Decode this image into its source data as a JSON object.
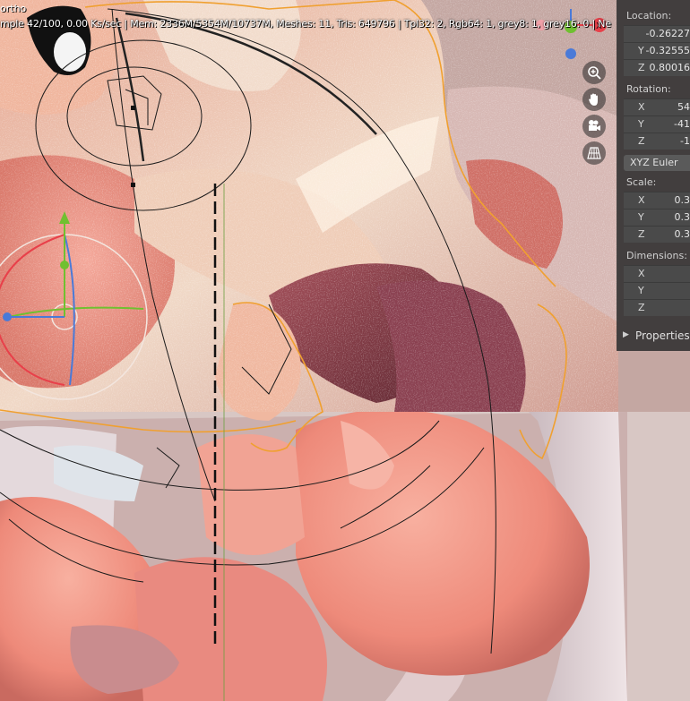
{
  "viewport": {
    "title_fragment": "ortho",
    "status": "mple 42/100, 0.00 Ks/sec | Mem: 2336M/5354M/10737M, Meshes: 11, Tris: 649796 | Tpl32: 2, Rgb64: 1, grey8: 1, grey16: 0 | Ne"
  },
  "gizmo": {
    "axis_x": "X",
    "axis_y": "Y",
    "axis_z": "Z"
  },
  "nav": {
    "zoom_icon": "zoom-icon",
    "pan_icon": "hand-icon",
    "camera_icon": "camera-icon",
    "grid_icon": "perspective-grid-icon"
  },
  "panel": {
    "location": {
      "label": "Location:",
      "x": "-0.26227",
      "y": "-0.32555",
      "z": "0.80016"
    },
    "rotation": {
      "label": "Rotation:",
      "x": "54",
      "y": "-41",
      "z": "-1",
      "mode": "XYZ Euler"
    },
    "scale": {
      "label": "Scale:",
      "x": "0.3",
      "y": "0.3",
      "z": "0.3"
    },
    "dimensions": {
      "label": "Dimensions:",
      "x": "",
      "y": "",
      "z": ""
    },
    "properties_label": "Properties",
    "axis_x": "X",
    "axis_y": "Y",
    "axis_z": "Z"
  },
  "colors": {
    "gizmo_x": "#e8404a",
    "gizmo_y": "#70c030",
    "gizmo_z": "#4a7ad8",
    "selection_outline": "#f0a030",
    "panel_bg": "#303030"
  }
}
